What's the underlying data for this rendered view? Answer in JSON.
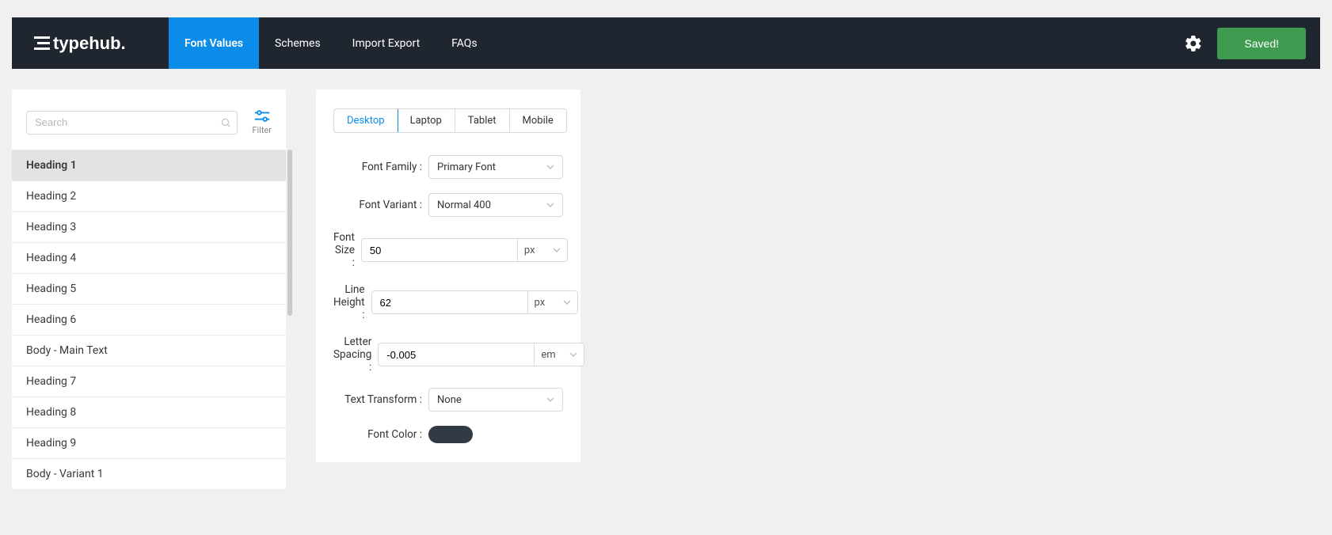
{
  "header": {
    "logo_text": "typehub.",
    "nav": [
      {
        "label": "Font Values",
        "active": true
      },
      {
        "label": "Schemes",
        "active": false
      },
      {
        "label": "Import Export",
        "active": false
      },
      {
        "label": "FAQs",
        "active": false
      }
    ],
    "save_label": "Saved!"
  },
  "sidebar": {
    "search_placeholder": "Search",
    "filter_label": "Filter",
    "items": [
      {
        "label": "Heading 1",
        "active": true
      },
      {
        "label": "Heading 2",
        "active": false
      },
      {
        "label": "Heading 3",
        "active": false
      },
      {
        "label": "Heading 4",
        "active": false
      },
      {
        "label": "Heading 5",
        "active": false
      },
      {
        "label": "Heading 6",
        "active": false
      },
      {
        "label": "Body - Main Text",
        "active": false
      },
      {
        "label": "Heading 7",
        "active": false
      },
      {
        "label": "Heading 8",
        "active": false
      },
      {
        "label": "Heading 9",
        "active": false
      },
      {
        "label": "Body - Variant 1",
        "active": false
      }
    ]
  },
  "panel": {
    "tabs": [
      {
        "label": "Desktop",
        "active": true
      },
      {
        "label": "Laptop",
        "active": false
      },
      {
        "label": "Tablet",
        "active": false
      },
      {
        "label": "Mobile",
        "active": false
      }
    ],
    "fields": {
      "font_family": {
        "label": "Font Family :",
        "value": "Primary Font"
      },
      "font_variant": {
        "label": "Font Variant :",
        "value": "Normal 400"
      },
      "font_size": {
        "label": "Font Size :",
        "value": "50",
        "unit": "px"
      },
      "line_height": {
        "label": "Line Height :",
        "value": "62",
        "unit": "px"
      },
      "letter_spacing": {
        "label": "Letter Spacing :",
        "value": "-0.005",
        "unit": "em"
      },
      "text_transform": {
        "label": "Text Transform :",
        "value": "None"
      },
      "font_color": {
        "label": "Font Color :",
        "value": "#323a45"
      }
    }
  }
}
